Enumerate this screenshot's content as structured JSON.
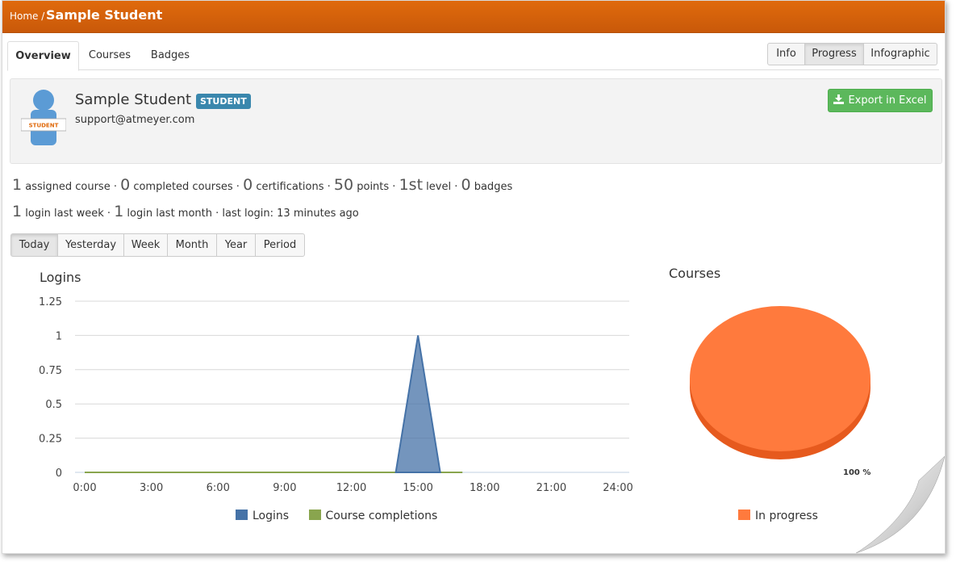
{
  "header": {
    "home": "Home",
    "sep": " /",
    "title": "Sample Student"
  },
  "tabs": [
    "Overview",
    "Courses",
    "Badges"
  ],
  "views": [
    "Info",
    "Progress",
    "Infographic"
  ],
  "profile": {
    "name": "Sample Student",
    "role_badge": "STUDENT",
    "avatar_label": "STUDENT",
    "email": "support@atmeyer.com",
    "export_label": "Export in Excel"
  },
  "stats": {
    "assigned": "1",
    "assigned_label": "assigned course ·",
    "completed": "0",
    "completed_label": "completed courses ·",
    "certs": "0",
    "certs_label": "certifications ·",
    "points": "50",
    "points_label": "points ·",
    "level": "1st",
    "level_label": "level ·",
    "badges": "0",
    "badges_label": "badges",
    "login_week": "1",
    "login_week_label": "login last week ·",
    "login_month": "1",
    "login_month_label": "login last month · last login: 13 minutes ago"
  },
  "ranges": [
    "Today",
    "Yesterday",
    "Week",
    "Month",
    "Year",
    "Period"
  ],
  "colors": {
    "logins": "#4572a7",
    "completions": "#89a54e",
    "in_progress": "#ff7a3d"
  },
  "chart_data": [
    {
      "type": "area",
      "title": "Logins",
      "x": [
        "0:00",
        "3:00",
        "6:00",
        "9:00",
        "12:00",
        "15:00",
        "18:00",
        "21:00",
        "24:00"
      ],
      "ylim": [
        0,
        1.25
      ],
      "yticks": [
        "0",
        "0.25",
        "0.5",
        "0.75",
        "1",
        "1.25"
      ],
      "series": [
        {
          "name": "Logins",
          "points": [
            [
              14,
              0
            ],
            [
              15,
              1
            ],
            [
              16,
              0
            ]
          ]
        },
        {
          "name": "Course completions",
          "points": [
            [
              0,
              0
            ],
            [
              17,
              0
            ]
          ]
        }
      ]
    },
    {
      "type": "pie",
      "title": "Courses",
      "slices": [
        {
          "name": "In progress",
          "value": 100,
          "label": "100 %"
        }
      ]
    }
  ]
}
